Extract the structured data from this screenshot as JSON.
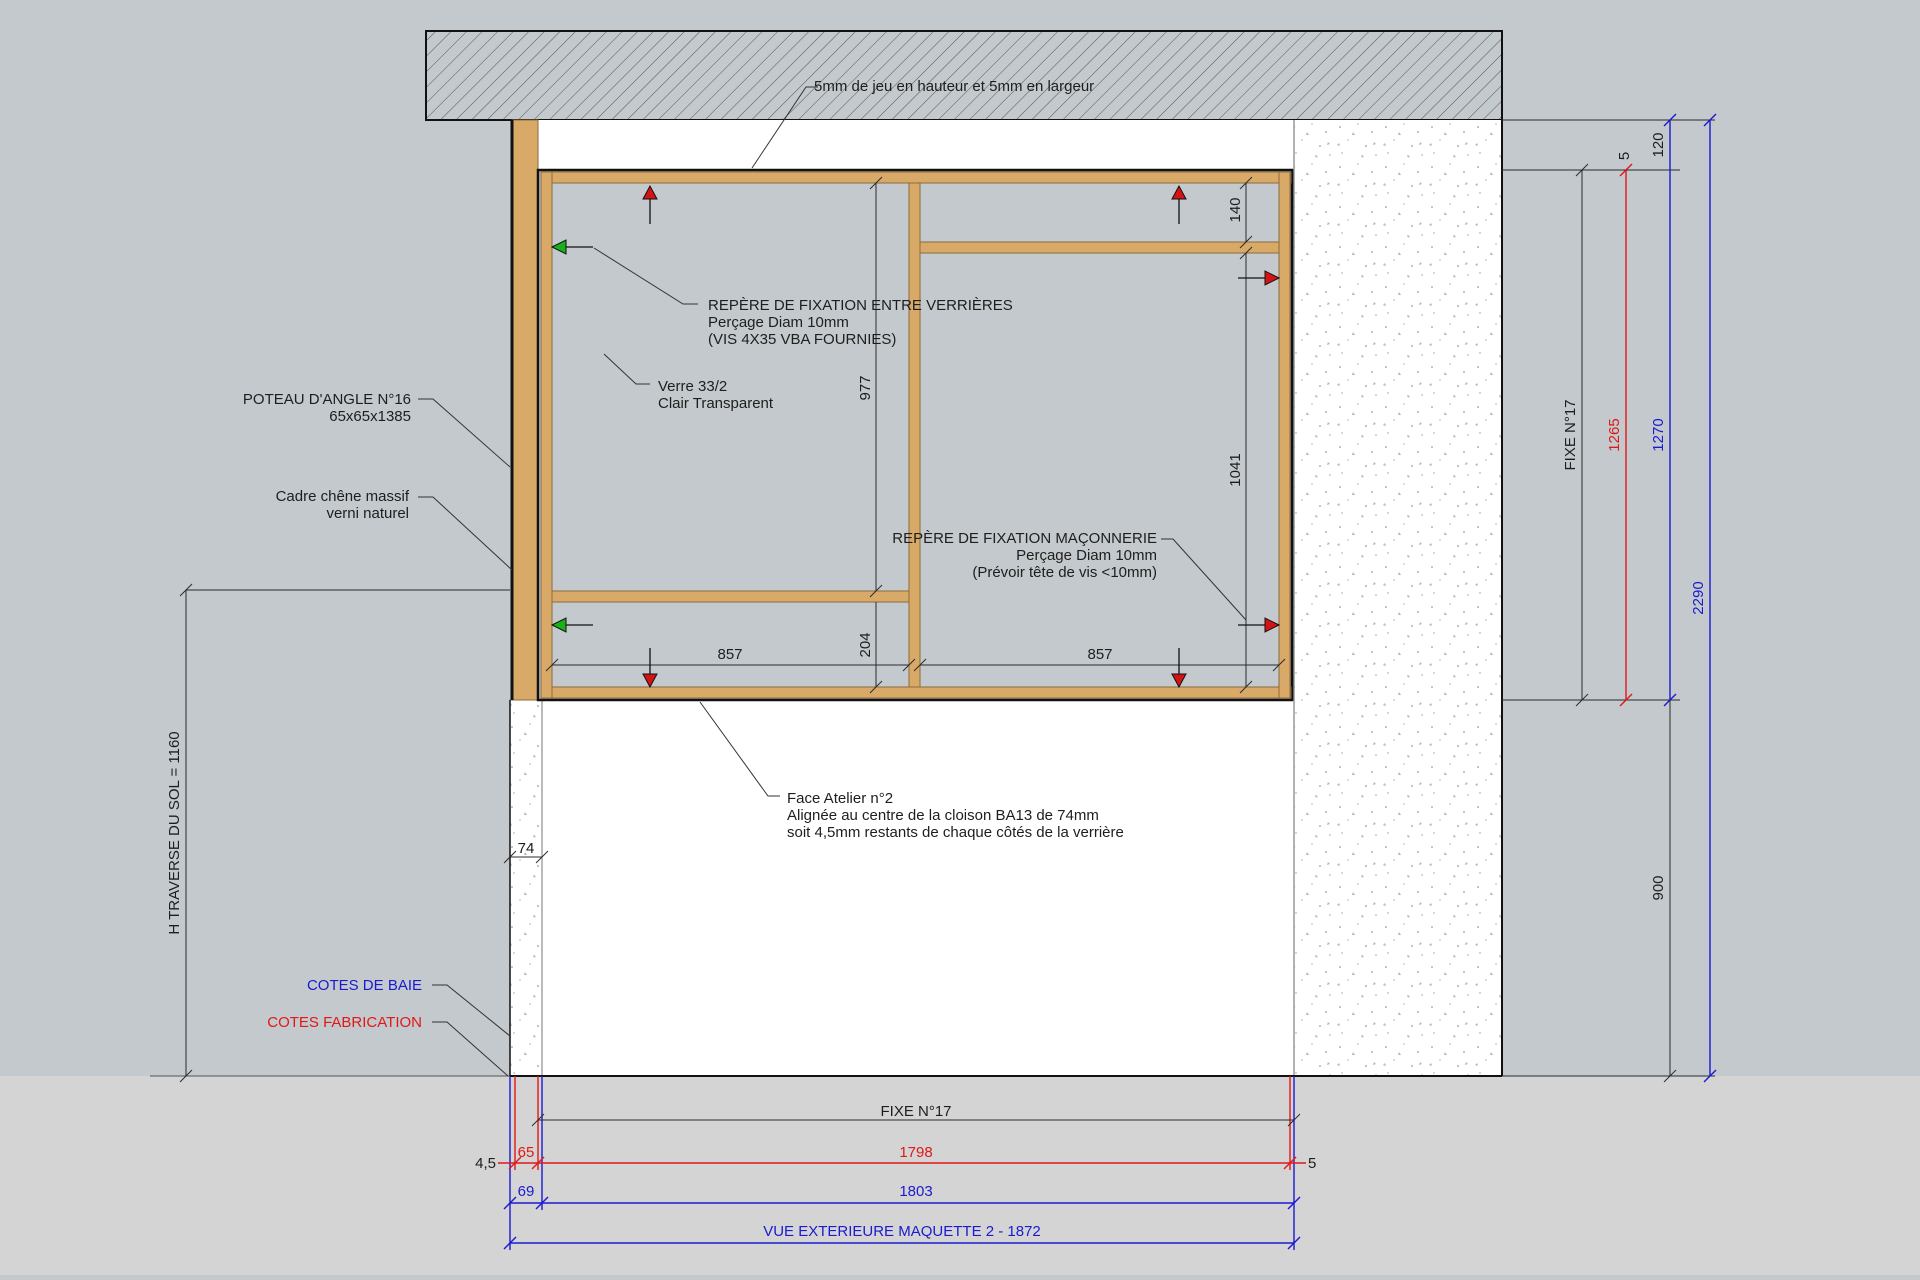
{
  "colors": {
    "background": "#c3c9cc",
    "floor": "#d4d4d4",
    "wood": "#d9a968",
    "bay_dimension": "#1a1ad0",
    "fabrication_dimension": "#e01818",
    "fix_arrow_red": "#d41414",
    "fix_arrow_green": "#19b019"
  },
  "icons": {
    "masonry_fixing": "red-arrow-icon",
    "inter_window_fixing": "green-arrow-icon"
  },
  "annotations": {
    "gap_note": "5mm de jeu en hauteur et 5mm en largeur",
    "fix_between": {
      "line1": "REPÈRE DE FIXATION ENTRE VERRIÈRES",
      "line2": "Perçage Diam 10mm",
      "line3": "(VIS 4X35 VBA FOURNIES)"
    },
    "glass": {
      "line1": "Verre 33/2",
      "line2": "Clair Transparent"
    },
    "post": {
      "line1": "POTEAU D'ANGLE  N°16",
      "line2": "65x65x1385"
    },
    "frame": {
      "line1": "Cadre chêne massif",
      "line2": "verni naturel"
    },
    "masonry": {
      "line1": "REPÈRE DE FIXATION MAÇONNERIE",
      "line2": "Perçage Diam 10mm",
      "line3": "(Prévoir tête de vis <10mm)"
    },
    "face": {
      "line1": "Face Atelier n°2",
      "line2": "Alignée au centre de la cloison BA13 de 74mm",
      "line3": "soit 4,5mm restants de chaque côtés de la verrière"
    },
    "legend_bay": "COTES DE BAIE",
    "legend_fab": "COTES FABRICATION"
  },
  "dimensions": {
    "height_from_floor": "H TRAVERSE DU SOL = 1160",
    "wall_74": "74",
    "inner_977": "977",
    "inner_204": "204",
    "inner_140": "140",
    "inner_1041": "1041",
    "inner_857_left": "857",
    "inner_857_right": "857",
    "right_5": "5",
    "right_120": "120",
    "right_fixe": "FIXE N°17",
    "right_1265": "1265",
    "right_1270": "1270",
    "right_2290": "2290",
    "right_900": "900",
    "bottom_fixe": "FIXE N°17",
    "bottom_45": "4,5",
    "bottom_65": "65",
    "bottom_1798": "1798",
    "bottom_5": "5",
    "bottom_69": "69",
    "bottom_1803": "1803",
    "bottom_total": "VUE EXTERIEURE MAQUETTE 2 - 1872"
  }
}
